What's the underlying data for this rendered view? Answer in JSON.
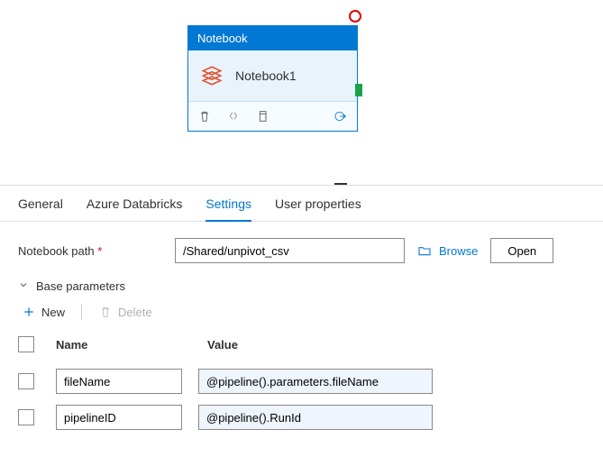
{
  "activity": {
    "header": "Notebook",
    "title": "Notebook1"
  },
  "tabs": {
    "general": "General",
    "databricks": "Azure Databricks",
    "settings": "Settings",
    "userprops": "User properties"
  },
  "settings": {
    "notebook_path_label": "Notebook path",
    "notebook_path_value": "/Shared/unpivot_csv",
    "browse_label": "Browse",
    "open_label": "Open",
    "base_params_label": "Base parameters",
    "new_label": "New",
    "delete_label": "Delete",
    "col_name": "Name",
    "col_value": "Value",
    "rows": [
      {
        "name": "fileName",
        "value": "@pipeline().parameters.fileName"
      },
      {
        "name": "pipelineID",
        "value": "@pipeline().RunId"
      }
    ]
  }
}
